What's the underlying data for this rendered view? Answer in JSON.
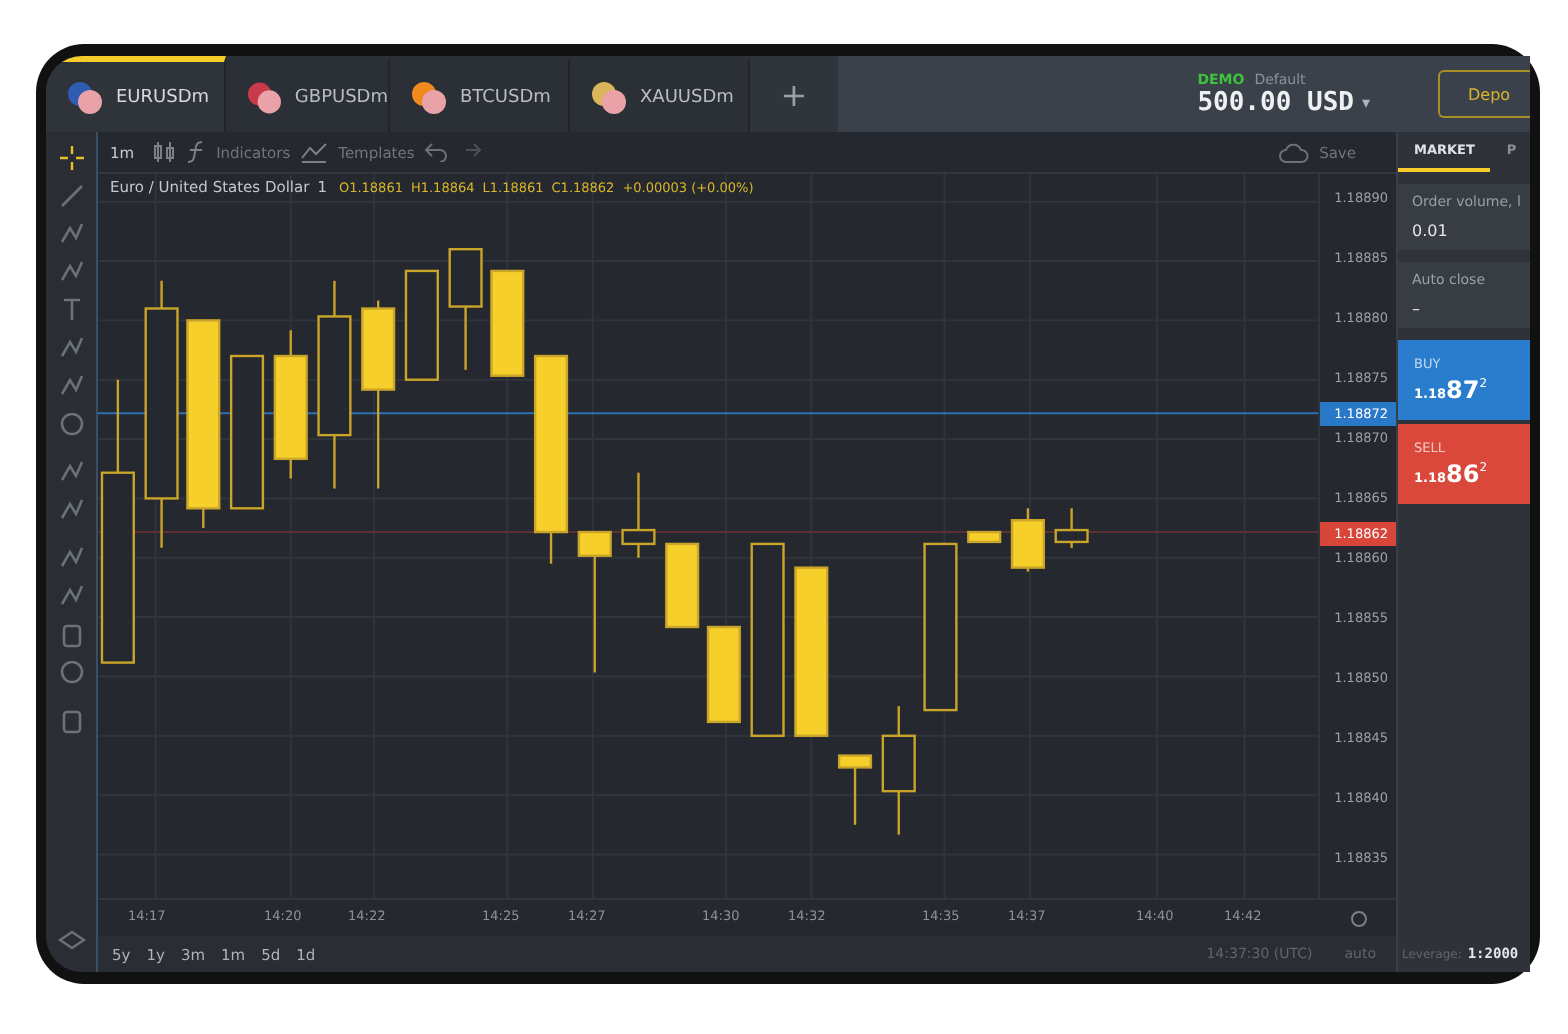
{
  "tabs": [
    {
      "label": "EURUSDm",
      "selected": true
    },
    {
      "label": "GBPUSDm",
      "selected": false
    },
    {
      "label": "BTCUSDm",
      "selected": false
    },
    {
      "label": "XAUUSDm",
      "selected": false
    }
  ],
  "add_tab": "+",
  "account": {
    "mode": "DEMO",
    "name": "Default",
    "balance": "500.00 USD",
    "caret": "▾"
  },
  "deposit_button": "Depo",
  "chart_toolbar": {
    "interval": "1m",
    "indicators": "Indicators",
    "templates": "Templates",
    "save": "Save"
  },
  "legend": {
    "symbol": "Euro / United States Dollar",
    "interval": "1",
    "values": [
      "O1.18861",
      "H1.18864",
      "L1.18861",
      "C1.18862",
      "+0.00003 (+0.00%)"
    ]
  },
  "y_axis": [
    "1.18890",
    "1.18885",
    "1.18880",
    "1.18875",
    "1.18870",
    "1.18865",
    "1.18860",
    "1.18855",
    "1.18850",
    "1.18845",
    "1.18840",
    "1.18835"
  ],
  "price_markers": [
    {
      "label": "1.18872",
      "kind": "ask"
    },
    {
      "label": "1.18862",
      "kind": "bid"
    }
  ],
  "x_axis": [
    "14:17",
    "14:20",
    "14:22",
    "14:25",
    "14:27",
    "14:30",
    "14:32",
    "14:35",
    "14:37",
    "14:40",
    "14:42"
  ],
  "ranges": [
    "5y",
    "1y",
    "3m",
    "1m",
    "5d",
    "1d"
  ],
  "status": {
    "time": "14:37:30 (UTC)",
    "scale": "auto",
    "leverage_label": "Leverage:",
    "leverage": "1:2000"
  },
  "panel": {
    "tabs": [
      {
        "label": "MARKET",
        "selected": true
      },
      {
        "label": "P",
        "selected": false
      }
    ],
    "order_volume": {
      "label": "Order volume, l",
      "value": "0.01"
    },
    "auto_close": {
      "label": "Auto close",
      "value": "–"
    },
    "orders": [
      {
        "kind": "buy",
        "label": "BUY",
        "prefix": "1.18",
        "big": "87",
        "sup": "2"
      },
      {
        "kind": "sell",
        "label": "SELL",
        "prefix": "1.18",
        "big": "86",
        "sup": "2"
      }
    ]
  }
}
